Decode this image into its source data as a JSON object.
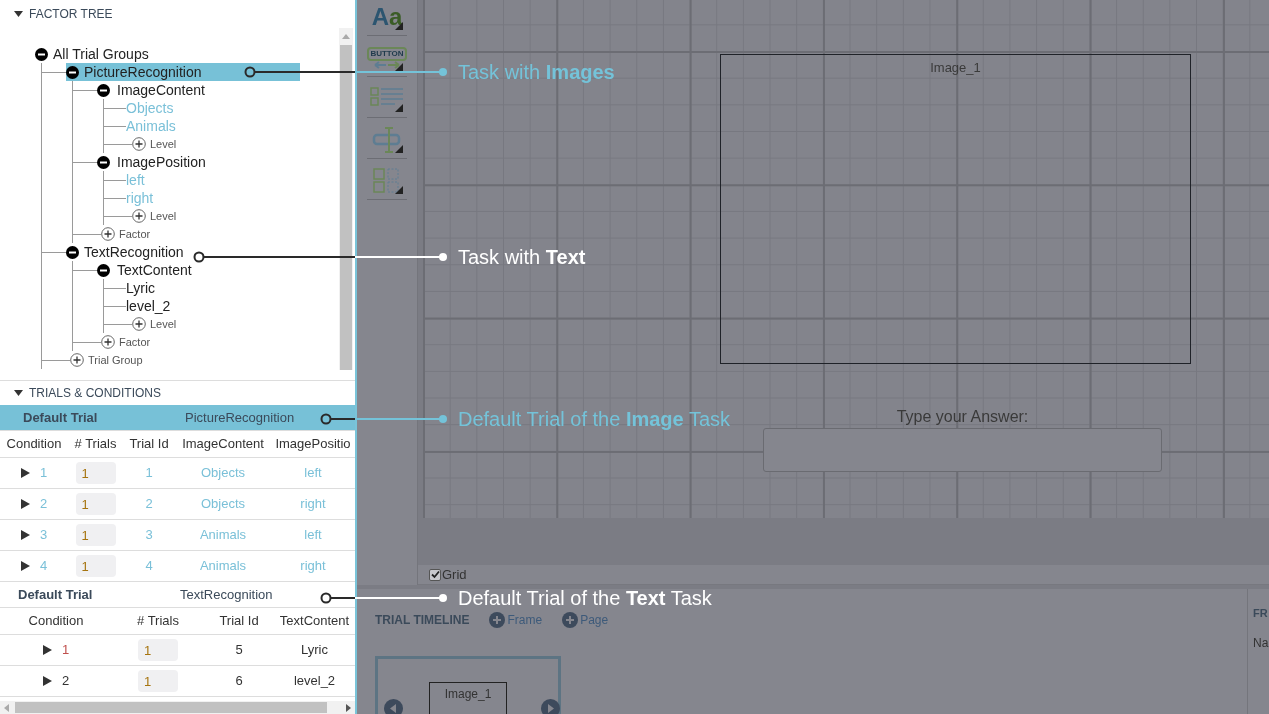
{
  "factor_tree": {
    "title": "FACTOR TREE",
    "expanded": true,
    "root": {
      "label": "All Trial Groups",
      "add_label": "Trial Group",
      "groups": [
        {
          "label": "PictureRecognition",
          "selected": true,
          "add_label": "Factor",
          "factors": [
            {
              "label": "ImageContent",
              "add_label": "Level",
              "levels": [
                "Objects",
                "Animals"
              ]
            },
            {
              "label": "ImagePosition",
              "add_label": "Level",
              "levels": [
                "left",
                "right"
              ]
            }
          ]
        },
        {
          "label": "TextRecognition",
          "selected": false,
          "add_label": "Factor",
          "factors": [
            {
              "label": "TextContent",
              "add_label": "Level",
              "levels": [
                "Lyric",
                "level_2"
              ]
            }
          ]
        }
      ]
    }
  },
  "trials": {
    "title": "TRIALS & CONDITIONS",
    "expanded": true,
    "tables": [
      {
        "name": "Default Trial",
        "group": "PictureRecognition",
        "selected": true,
        "columns": [
          "Condition",
          "# Trials",
          "Trial Id",
          "ImageContent",
          "ImagePositio"
        ],
        "rows": [
          {
            "condition": "1",
            "count": "1",
            "trial_id": "1",
            "values": [
              "Objects",
              "left"
            ],
            "selected": false
          },
          {
            "condition": "2",
            "count": "1",
            "trial_id": "2",
            "values": [
              "Objects",
              "right"
            ],
            "selected": false
          },
          {
            "condition": "3",
            "count": "1",
            "trial_id": "3",
            "values": [
              "Animals",
              "left"
            ],
            "selected": false
          },
          {
            "condition": "4",
            "count": "1",
            "trial_id": "4",
            "values": [
              "Animals",
              "right"
            ],
            "selected": false
          }
        ]
      },
      {
        "name": "Default Trial",
        "group": "TextRecognition",
        "selected": false,
        "columns": [
          "Condition",
          "# Trials",
          "Trial Id",
          "TextContent"
        ],
        "rows": [
          {
            "condition": "1",
            "count": "1",
            "trial_id": "5",
            "values": [
              "Lyric"
            ],
            "selected": true
          },
          {
            "condition": "2",
            "count": "1",
            "trial_id": "6",
            "values": [
              "level_2"
            ],
            "selected": false
          }
        ]
      }
    ]
  },
  "toolbar": [
    {
      "kind": "text",
      "label": "Aa"
    },
    {
      "kind": "button",
      "label": "BUTTON"
    },
    {
      "kind": "list"
    },
    {
      "kind": "input"
    },
    {
      "kind": "layout"
    }
  ],
  "canvas": {
    "elements": [
      {
        "kind": "image",
        "label": "Image_1"
      },
      {
        "kind": "text",
        "label": "Type your Answer:"
      },
      {
        "kind": "input"
      }
    ],
    "grid": {
      "label": "Grid",
      "checked": true
    }
  },
  "timeline": {
    "title": "TRIAL TIMELINE",
    "actions": [
      "Frame",
      "Page"
    ],
    "frames": [
      {
        "label": "Image_1",
        "selected": true
      }
    ]
  },
  "properties": {
    "title": "FR",
    "field_label": "Na"
  },
  "annotations": [
    {
      "label": "Task with **Images**",
      "color": "#74c3d9"
    },
    {
      "label": "Task with **Text**",
      "color": "#ffffff"
    },
    {
      "label": "Default Trial of the **Image** Task",
      "color": "#74c3d9"
    },
    {
      "label": "Default Trial of the **Text** Task",
      "color": "#ffffff"
    }
  ]
}
